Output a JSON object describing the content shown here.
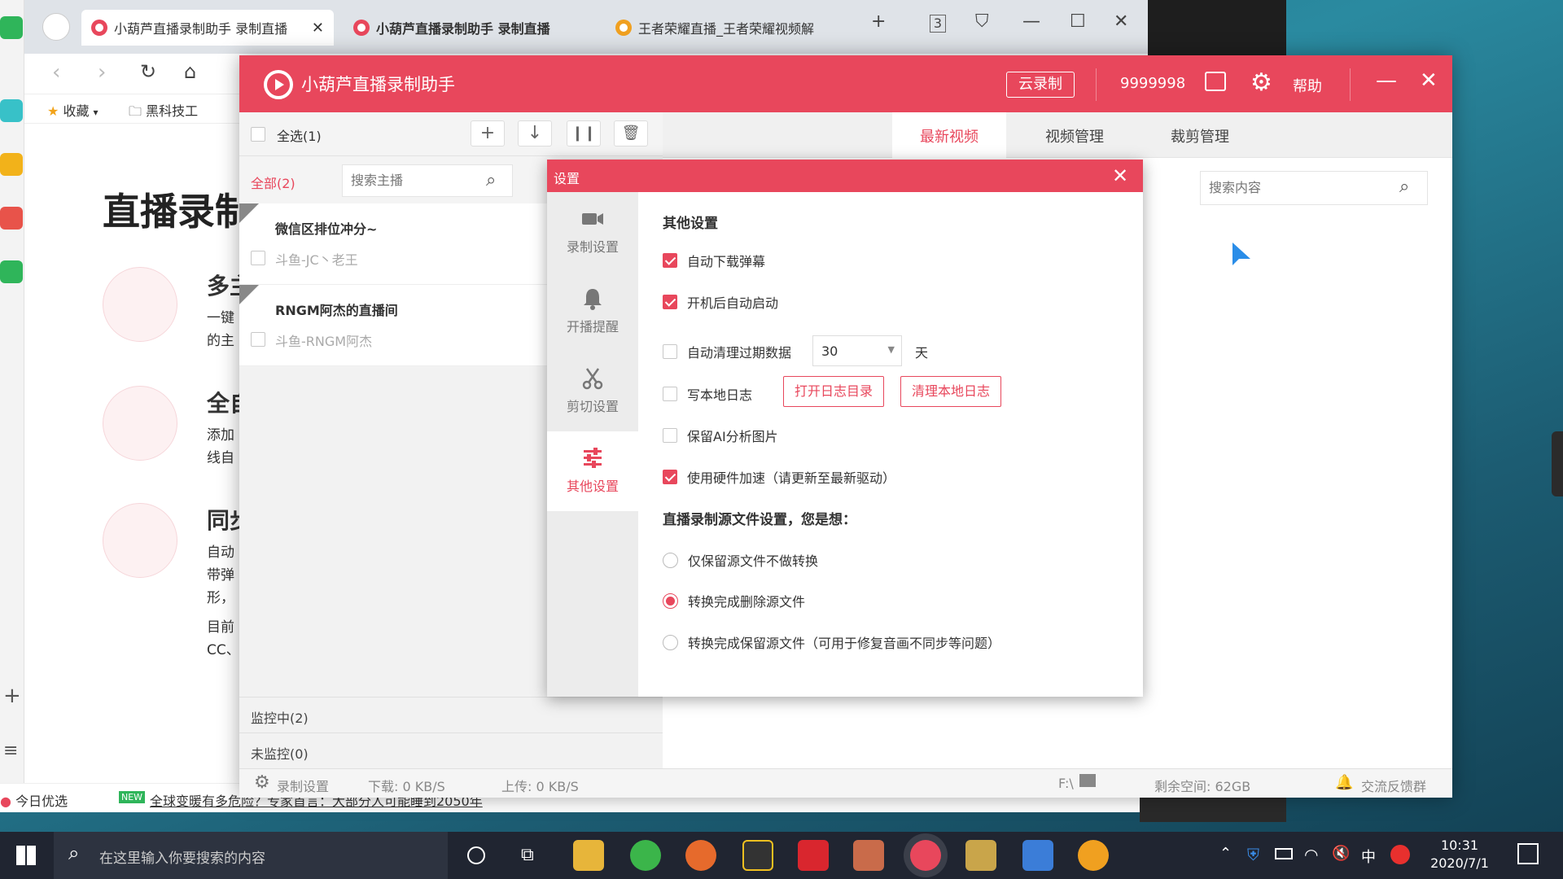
{
  "browser": {
    "tabs": [
      {
        "label": "小葫芦直播录制助手 录制直播"
      },
      {
        "label": "小葫芦直播录制助手 录制直播"
      },
      {
        "label": "王者荣耀直播_王者荣耀视频解"
      }
    ],
    "tab_count_badge": "3",
    "bookmarks": {
      "favorites": "收藏",
      "folder1": "黑科技工"
    },
    "page": {
      "heading": "直播录制",
      "features": [
        {
          "title": "多主",
          "lines": [
            "一键",
            "的主"
          ]
        },
        {
          "title": "全自",
          "lines": [
            "添加",
            "线自"
          ]
        },
        {
          "title": "同步",
          "lines": [
            "自动",
            "带弹",
            "形，",
            "",
            "目前",
            "CC、"
          ]
        }
      ]
    },
    "bottom": {
      "today": "今日优选",
      "new_badge": "NEW",
      "news": "全球变暖有多危险？专家首言：大部分人可能睡到2050年"
    }
  },
  "app": {
    "title": "小葫芦直播录制助手",
    "cloud_record": "云录制",
    "user_id": "9999998",
    "help": "帮助",
    "select_all": "全选(1)",
    "filter_all": "全部(2)",
    "search_anchor_placeholder": "搜索主播",
    "anchors": [
      {
        "title": "微信区排位冲分~",
        "sub": "斗鱼-JC丶老王"
      },
      {
        "title": "RNGM阿杰的直播间",
        "sub": "斗鱼-RNGM阿杰"
      }
    ],
    "monitoring": "监控中(2)",
    "not_monitoring": "未监控(0)",
    "tabs": [
      "最新视频",
      "视频管理",
      "裁剪管理"
    ],
    "search_content_placeholder": "搜索内容",
    "status": {
      "record_settings": "录制设置",
      "download": "下载: 0 KB/S",
      "upload": "上传: 0 KB/S",
      "drive": "F:\\",
      "free_space": "剩余空间: 62GB",
      "feedback": "交流反馈群"
    }
  },
  "settings": {
    "title": "设置",
    "side": [
      {
        "label": "录制设置",
        "icon": "camera-icon"
      },
      {
        "label": "开播提醒",
        "icon": "bell-icon"
      },
      {
        "label": "剪切设置",
        "icon": "scissors-icon"
      },
      {
        "label": "其他设置",
        "icon": "sliders-icon"
      }
    ],
    "section_other": "其他设置",
    "options": [
      {
        "label": "自动下载弹幕",
        "checked": true
      },
      {
        "label": "开机后自动启动",
        "checked": true
      },
      {
        "label": "自动清理过期数据",
        "checked": false
      },
      {
        "label": "写本地日志",
        "checked": false
      },
      {
        "label": "保留AI分析图片",
        "checked": false
      },
      {
        "label": "使用硬件加速（请更新至最新驱动）",
        "checked": true
      }
    ],
    "days_value": "30",
    "days_unit": "天",
    "open_log_dir": "打开日志目录",
    "clear_log": "清理本地日志",
    "section_source": "直播录制源文件设置，您是想：",
    "radios": [
      {
        "label": "仅保留源文件不做转换",
        "selected": false
      },
      {
        "label": "转换完成删除源文件",
        "selected": true
      },
      {
        "label": "转换完成保留源文件（可用于修复音画不同步等问题）",
        "selected": false
      }
    ]
  },
  "taskbar": {
    "search_placeholder": "在这里输入你要搜索的内容",
    "ime": "中",
    "time": "10:31",
    "date": "2020/7/1"
  },
  "colors": {
    "accent": "#e8475c",
    "taskbar": "#202531"
  }
}
